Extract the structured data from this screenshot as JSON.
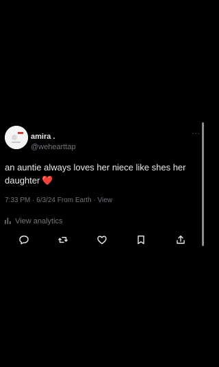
{
  "tweet": {
    "author": {
      "name": "amira .",
      "handle": "@wehearttap",
      "avatar_icon": "avatar-image"
    },
    "text": "an auntie always loves her niece like shes her daughter",
    "emoji": "❤️",
    "meta": {
      "time": "7:33 PM",
      "separator1": " · ",
      "date": "6/3/24",
      "source": " From Earth",
      "separator2": " · ",
      "view": "View"
    },
    "analytics_label": "View analytics",
    "more_label": "···",
    "actions": [
      "reply-icon",
      "retweet-icon",
      "like-icon",
      "bookmark-icon",
      "share-icon"
    ]
  },
  "colors": {
    "background": "#000000",
    "primary_text": "#e7e9ea",
    "secondary_text": "#71767b",
    "heart": "#f4212e"
  }
}
